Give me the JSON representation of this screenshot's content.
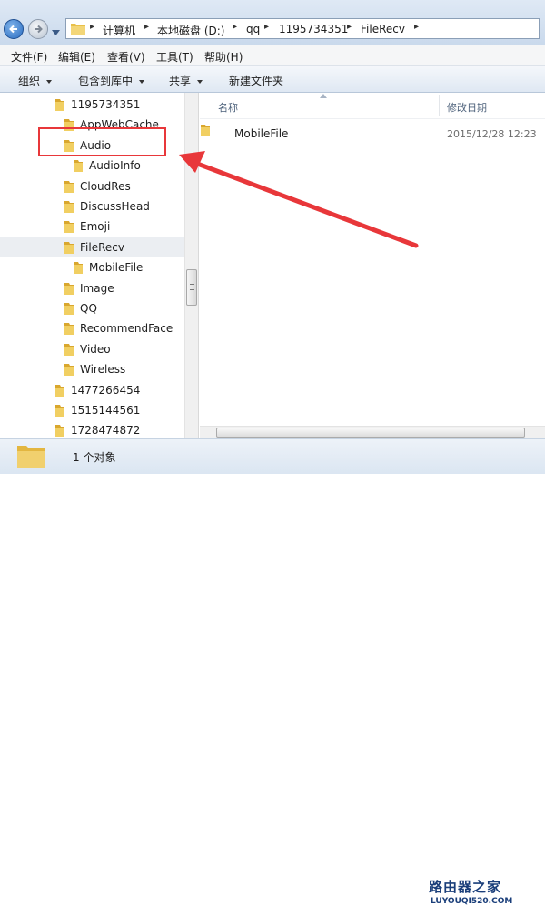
{
  "address_bar": {
    "path": [
      {
        "label": "计算机"
      },
      {
        "label": "本地磁盘 (D:)"
      },
      {
        "label": "qq"
      },
      {
        "label": "1195734351"
      },
      {
        "label": "FileRecv"
      }
    ]
  },
  "menu": [
    {
      "label": "文件(F)"
    },
    {
      "label": "编辑(E)"
    },
    {
      "label": "查看(V)"
    },
    {
      "label": "工具(T)"
    },
    {
      "label": "帮助(H)"
    }
  ],
  "toolbar": [
    {
      "label": "组织",
      "dropdown": true
    },
    {
      "label": "包含到库中",
      "dropdown": true
    },
    {
      "label": "共享",
      "dropdown": true
    },
    {
      "label": "新建文件夹",
      "dropdown": false
    }
  ],
  "nav_tree": [
    {
      "label": "1195734351",
      "level": 0
    },
    {
      "label": "AppWebCache",
      "level": 1
    },
    {
      "label": "Audio",
      "level": 1
    },
    {
      "label": "AudioInfo",
      "level": 2
    },
    {
      "label": "CloudRes",
      "level": 1
    },
    {
      "label": "DiscussHead",
      "level": 1
    },
    {
      "label": "Emoji",
      "level": 1
    },
    {
      "label": "FileRecv",
      "level": 1,
      "selected": true
    },
    {
      "label": "MobileFile",
      "level": 2
    },
    {
      "label": "Image",
      "level": 1
    },
    {
      "label": "QQ",
      "level": 1
    },
    {
      "label": "RecommendFace",
      "level": 1
    },
    {
      "label": "Video",
      "level": 1
    },
    {
      "label": "Wireless",
      "level": 1
    },
    {
      "label": "1477266454",
      "level": 0
    },
    {
      "label": "1515144561",
      "level": 0
    },
    {
      "label": "1728474872",
      "level": 0
    }
  ],
  "content": {
    "columns": {
      "name": "名称",
      "modified": "修改日期"
    },
    "files": [
      {
        "name": "MobileFile",
        "modified": "2015/12/28 12:23"
      }
    ]
  },
  "status": {
    "text": "1 个对象"
  },
  "annotation": {
    "color": "#e8373a"
  },
  "watermark": {
    "logo": "路由器之家",
    "url": "LUYOUQI520.COM"
  },
  "colors": {
    "folder": "#e8c04a",
    "address_bar_bg": "#cfdded",
    "selection": "#ebeef2"
  }
}
